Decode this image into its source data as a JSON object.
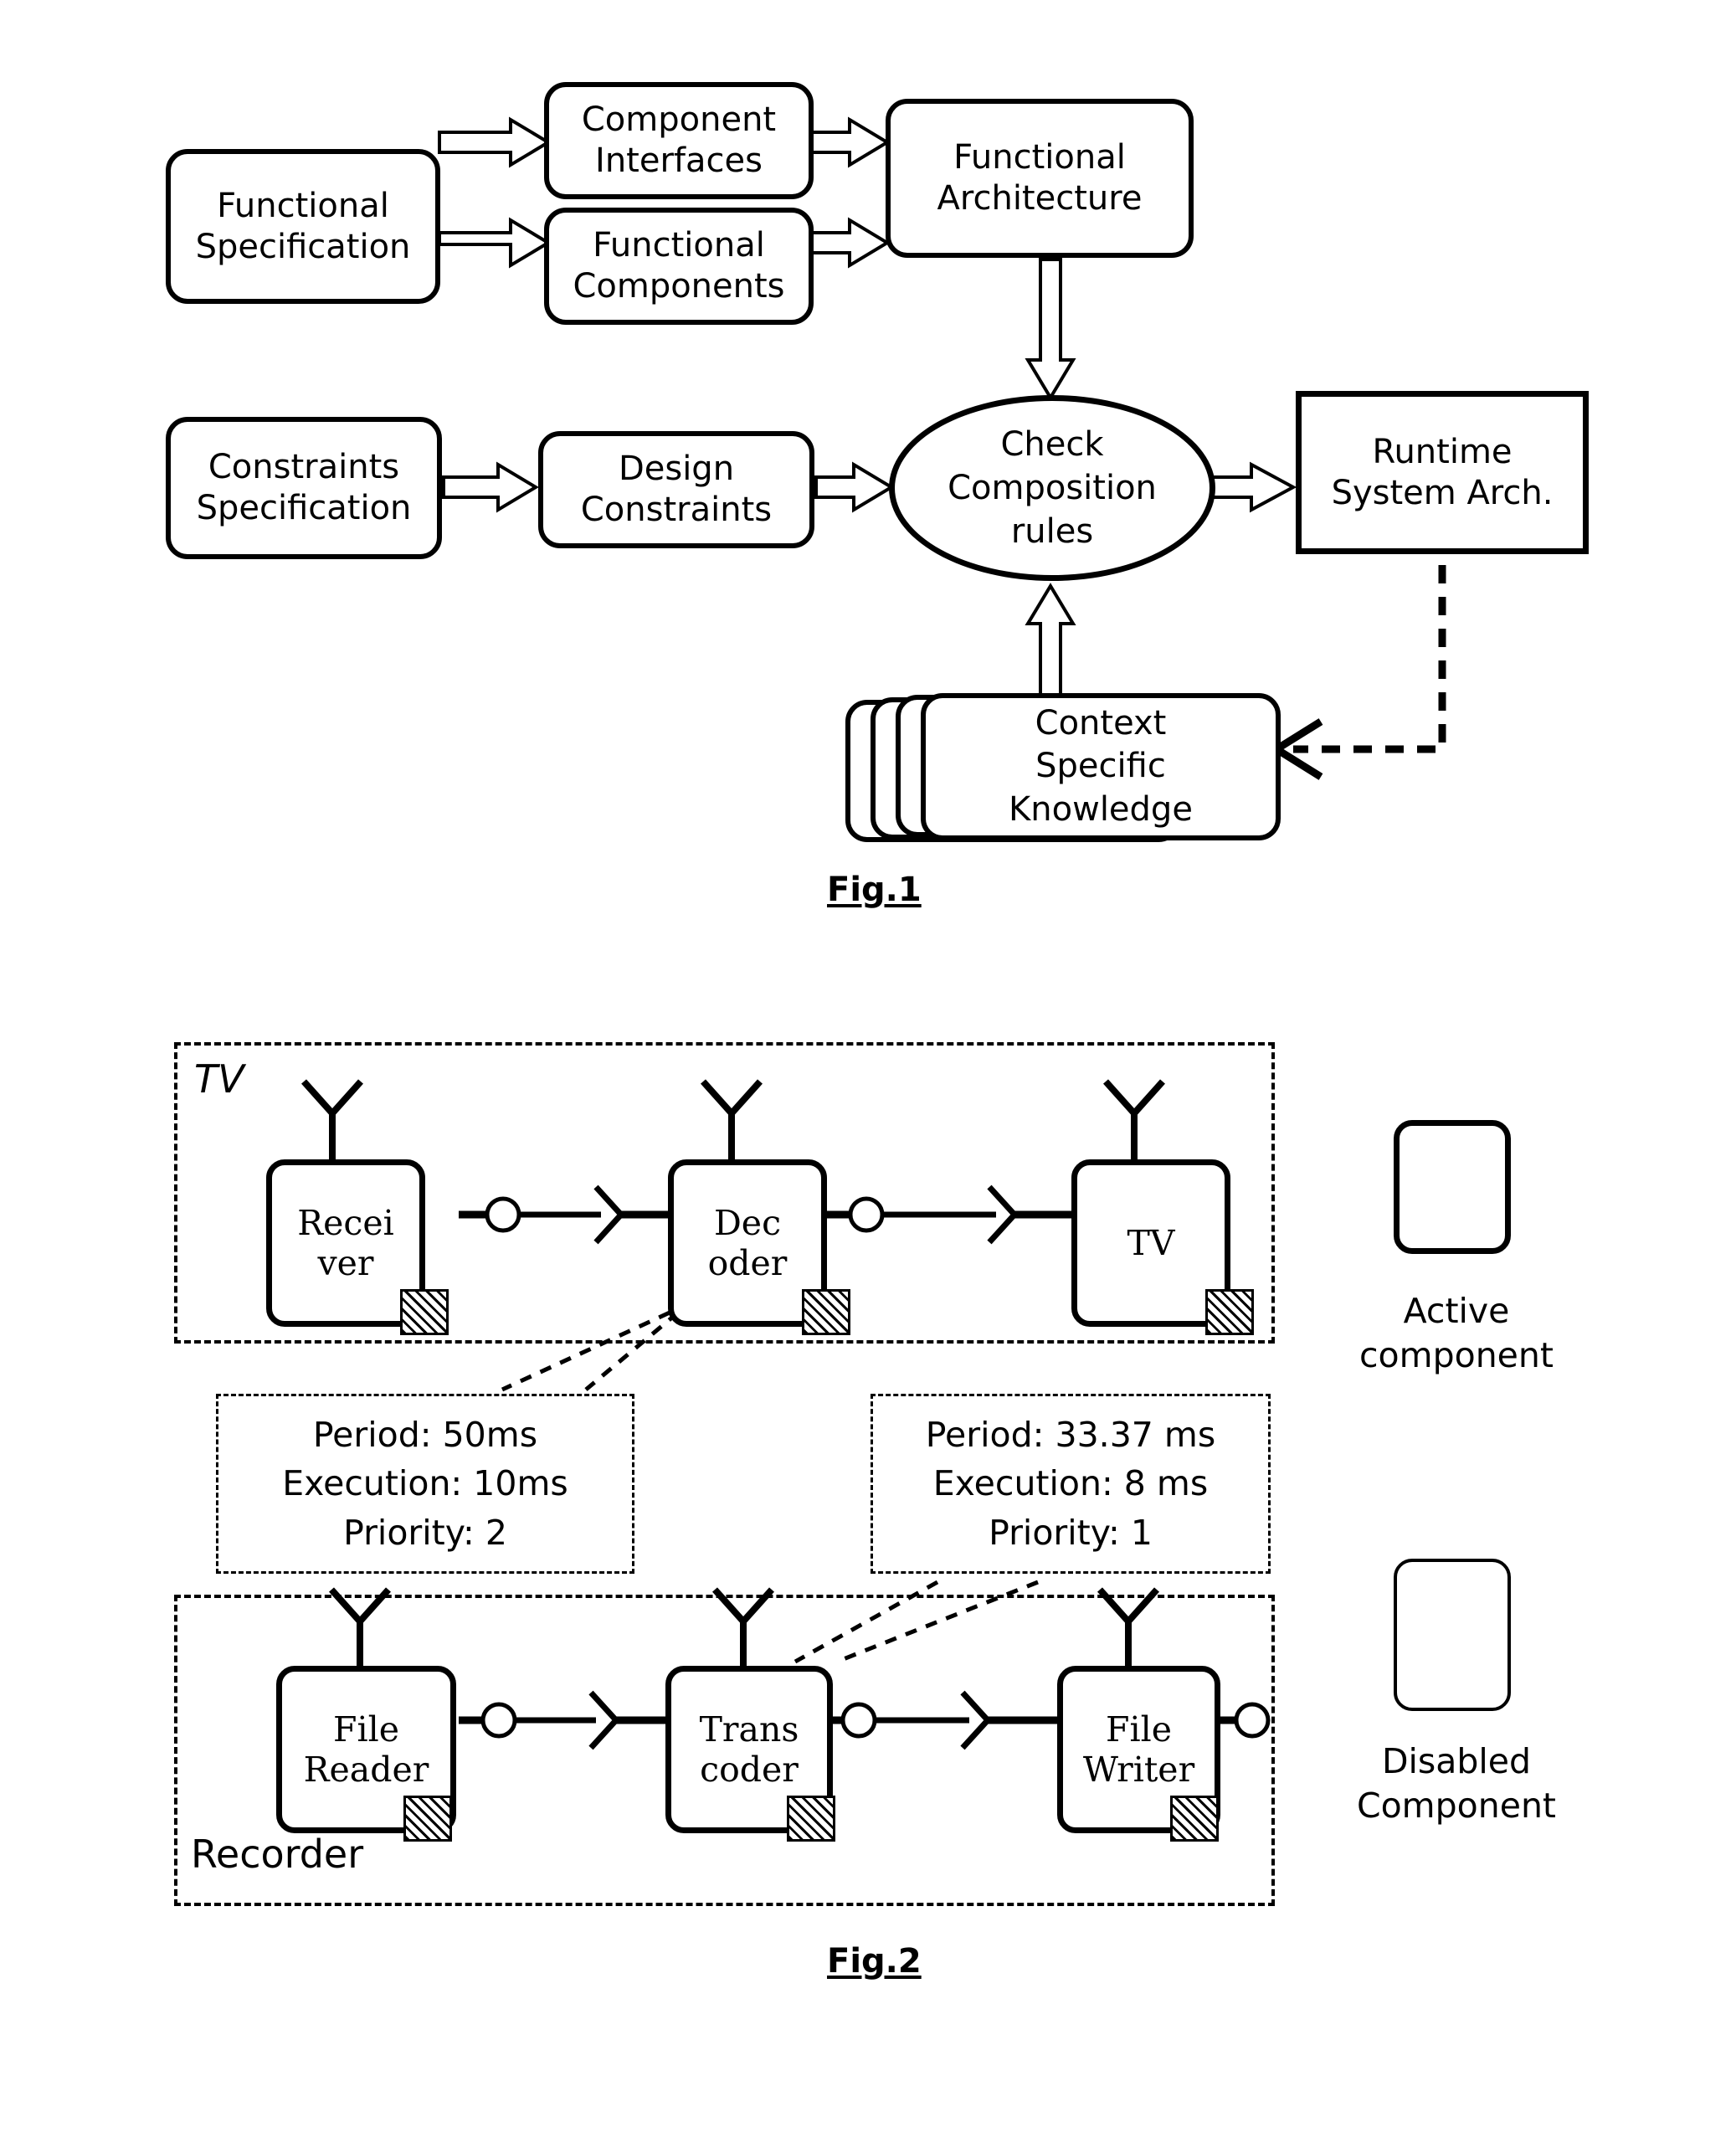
{
  "figure1": {
    "caption": "Fig.1",
    "nodes": [
      {
        "id": "functional_specification",
        "label_lines": [
          "Functional",
          "Specification"
        ]
      },
      {
        "id": "component_interfaces",
        "label_lines": [
          "Component",
          "Interfaces"
        ]
      },
      {
        "id": "functional_components",
        "label_lines": [
          "Functional",
          "Components"
        ]
      },
      {
        "id": "functional_architecture",
        "label_lines": [
          "Functional",
          "Architecture"
        ]
      },
      {
        "id": "constraints_specification",
        "label_lines": [
          "Constraints",
          "Specification"
        ]
      },
      {
        "id": "design_constraints",
        "label_lines": [
          "Design",
          "Constraints"
        ]
      },
      {
        "id": "check_composition_rules",
        "label_lines": [
          "Check",
          "Composition",
          "rules"
        ]
      },
      {
        "id": "runtime_system_arch",
        "label_lines": [
          "Runtime",
          "System Arch."
        ]
      },
      {
        "id": "context_specific_knowledge",
        "label_lines": [
          "Context",
          "Specific",
          "Knowledge"
        ]
      }
    ]
  },
  "figure2": {
    "caption": "Fig.2",
    "regions": [
      {
        "id": "tv_region",
        "label": "TV"
      },
      {
        "id": "recorder_region",
        "label": "Recorder"
      }
    ],
    "components": [
      {
        "id": "receiver",
        "label_lines": [
          "Recei",
          "ver"
        ],
        "state": "active"
      },
      {
        "id": "decoder",
        "label_lines": [
          "Dec",
          "oder"
        ],
        "state": "active"
      },
      {
        "id": "tv",
        "label_lines": [
          "TV"
        ],
        "state": "active"
      },
      {
        "id": "file_reader",
        "label_lines": [
          "File",
          "Reader"
        ],
        "state": "active"
      },
      {
        "id": "transcoder",
        "label_lines": [
          "Trans",
          "coder"
        ],
        "state": "active"
      },
      {
        "id": "file_writer",
        "label_lines": [
          "File",
          "Writer"
        ],
        "state": "active"
      }
    ],
    "annotations": [
      {
        "id": "decoder_properties",
        "lines": [
          "Period: 50ms",
          "Execution: 10ms",
          "Priority: 2"
        ],
        "period": "Period: 50ms",
        "execution": "Execution: 10ms",
        "priority": "Priority: 2"
      },
      {
        "id": "transcoder_properties",
        "lines": [
          "Period: 33.37 ms",
          "Execution: 8 ms",
          "Priority: 1"
        ],
        "period": "Period: 33.37 ms",
        "execution": "Execution: 8 ms",
        "priority": "Priority: 1"
      }
    ],
    "legend": [
      {
        "id": "active_component",
        "label_lines": [
          "Active",
          "component"
        ],
        "state": "active"
      },
      {
        "id": "disabled_component",
        "label_lines": [
          "Disabled",
          "Component"
        ],
        "state": "disabled"
      }
    ]
  },
  "colors": {
    "ink": "#000000",
    "paper": "#ffffff"
  }
}
